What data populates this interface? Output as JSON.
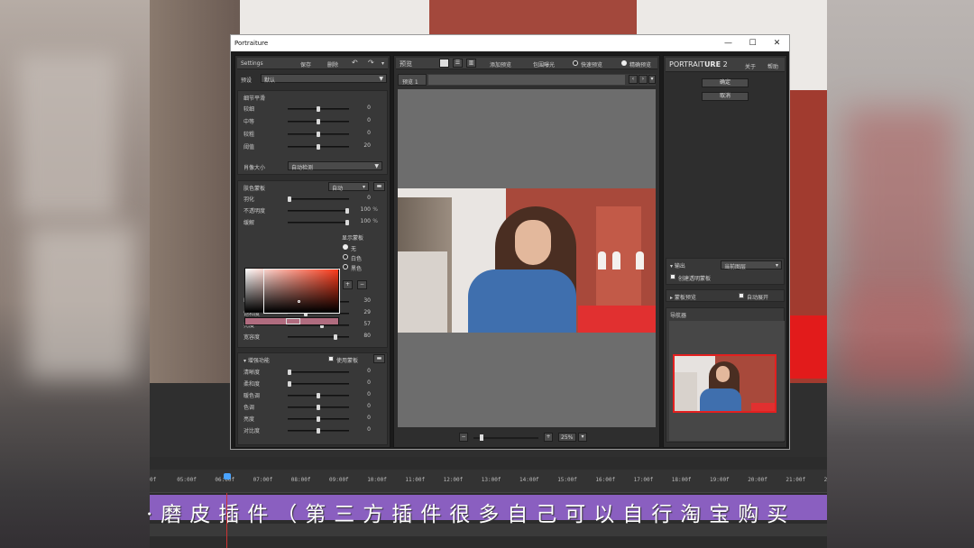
{
  "window": {
    "title": "Portraiture",
    "minimize": "—",
    "maximize": "☐",
    "close": "✕"
  },
  "left": {
    "settings_label": "Settings",
    "save_btn": "保存",
    "delete_btn": "删除",
    "undo": "↶",
    "redo": "↷",
    "menu": "▾",
    "preset_label": "预设",
    "preset_value": "默认",
    "detail_section": "细节平滑",
    "detail_sliders": [
      {
        "name": "较细",
        "value": "0",
        "pos": 0.5
      },
      {
        "name": "中等",
        "value": "0",
        "pos": 0.5
      },
      {
        "name": "较粗",
        "value": "0",
        "pos": 0.5
      },
      {
        "name": "阈值",
        "value": "20",
        "pos": 0.5
      }
    ],
    "portrait_size_label": "肖像大小",
    "portrait_size_value": "自动检测",
    "skin_section": "肤色蒙板",
    "skin_mode": "自动",
    "skin_sliders": [
      {
        "name": "羽化",
        "value": "0",
        "unit": "",
        "pos": 0.0
      },
      {
        "name": "不透明度",
        "value": "100",
        "unit": "%",
        "pos": 1.0
      },
      {
        "name": "缓解",
        "value": "100",
        "unit": "%",
        "pos": 1.0
      }
    ],
    "mask_display_label": "显示蒙板",
    "mask_options": [
      "无",
      "白色",
      "黑色"
    ],
    "eyedropper_plus": "+",
    "eyedropper_minus": "−",
    "hsl_sliders": [
      {
        "name": "Hue",
        "value": "30",
        "pos": 0.45
      },
      {
        "name": "饱和度",
        "value": "29",
        "pos": 0.28
      },
      {
        "name": "亮度",
        "value": "57",
        "pos": 0.57
      },
      {
        "name": "宽容度",
        "value": "80",
        "pos": 0.8
      }
    ],
    "enhance_section": "增强功能",
    "enhance_checkbox": "使用蒙板",
    "enhance_sliders": [
      {
        "name": "清晰度",
        "value": "0",
        "pos": 0.0
      },
      {
        "name": "柔和度",
        "value": "0",
        "pos": 0.0
      },
      {
        "name": "暖色调",
        "value": "0",
        "pos": 0.5
      },
      {
        "name": "色调",
        "value": "0",
        "pos": 0.5
      },
      {
        "name": "亮度",
        "value": "0",
        "pos": 0.5
      },
      {
        "name": "对比度",
        "value": "0",
        "pos": 0.5
      }
    ]
  },
  "middle": {
    "preview_label": "预览",
    "add_preview": "添加预览",
    "clip_exposure": "包围曝光",
    "quick_preview": "快速预览",
    "selective_preview": "精确预览",
    "tab_label": "预览 1",
    "prev": "‹",
    "next": "›",
    "tab_menu": "▾",
    "zoom_minus": "−",
    "zoom_plus": "+",
    "zoom_value": "25%",
    "zoom_caret": "▾",
    "zoom_pos": 0.1
  },
  "right": {
    "brand_a": "PORTRAIT",
    "brand_b": "URE",
    "brand_ver": "2",
    "about_btn": "关于",
    "help_btn": "帮助",
    "ok_btn": "确定",
    "cancel_btn": "取消",
    "output_label": "输出",
    "output_value": "当前图层",
    "transparent_label": "创建透明蒙板",
    "batch_label": "蒙板预览",
    "auto_expand": "自动展开",
    "navigator_label": "导航器"
  },
  "timeline": {
    "ticks": [
      "0f",
      "05:00f",
      "06:00f",
      "07:00f",
      "08:00f",
      "09:00f",
      "10:00f",
      "11:00f",
      "12:00f",
      "13:00f",
      "14:00f",
      "15:00f",
      "16:00f",
      "17:00f",
      "18:00f",
      "19:00f",
      "20:00f",
      "21:00f",
      "2"
    ],
    "subtitle": "·磨皮插件（第三方插件很多自己可以自行淘宝购买"
  }
}
